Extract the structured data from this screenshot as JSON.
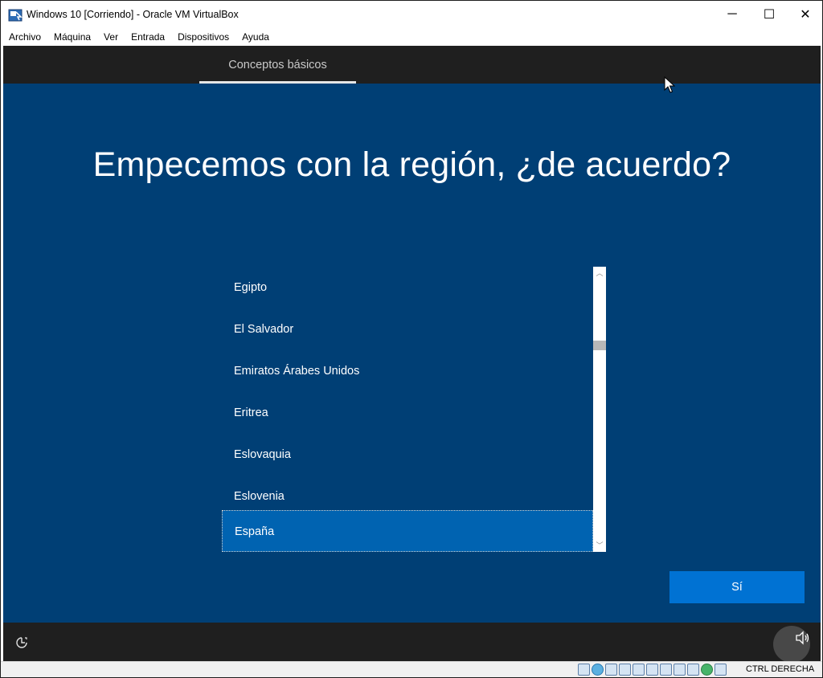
{
  "window": {
    "title": "Windows 10 [Corriendo] - Oracle VM VirtualBox",
    "controls": {
      "minimize": "─",
      "maximize": "☐",
      "close": "✕"
    }
  },
  "menubar": {
    "items": [
      "Archivo",
      "Máquina",
      "Ver",
      "Entrada",
      "Dispositivos",
      "Ayuda"
    ]
  },
  "setup": {
    "tab": "Conceptos básicos",
    "headline": "Empecemos con la región, ¿de acuerdo?",
    "regions": [
      "Egipto",
      "El Salvador",
      "Emiratos Árabes Unidos",
      "Eritrea",
      "Eslovaquia",
      "Eslovenia",
      "España"
    ],
    "selected_region": "España",
    "confirm_button": "Sí"
  },
  "statusbar": {
    "host_key": "CTRL DERECHA"
  },
  "colors": {
    "background": "#003f75",
    "selected": "#0063b1",
    "button": "#0072d3"
  }
}
